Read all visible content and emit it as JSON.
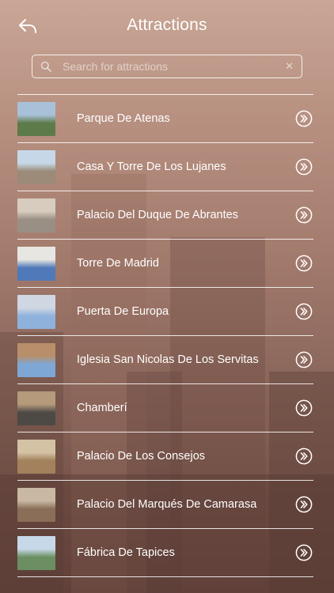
{
  "header": {
    "title": "Attractions",
    "back_icon": "back-arrow-icon"
  },
  "search": {
    "placeholder": "Search for attractions",
    "value": ""
  },
  "items": [
    {
      "label": "Parque De Atenas",
      "thumb_colors": [
        "#5d7a4a",
        "#a9c1d8"
      ]
    },
    {
      "label": "Casa Y Torre De Los Lujanes",
      "thumb_colors": [
        "#9b8b78",
        "#c6d8e8"
      ]
    },
    {
      "label": "Palacio Del Duque De Abrantes",
      "thumb_colors": [
        "#9a8f84",
        "#d7ccbd"
      ]
    },
    {
      "label": "Torre De Madrid",
      "thumb_colors": [
        "#4f79b8",
        "#e8e6e2"
      ]
    },
    {
      "label": "Puerta De Europa",
      "thumb_colors": [
        "#8fb2dc",
        "#cfd8e2"
      ]
    },
    {
      "label": "Iglesia San Nicolas De Los Servitas",
      "thumb_colors": [
        "#7fa7d6",
        "#b98e6a"
      ]
    },
    {
      "label": "Chamberí",
      "thumb_colors": [
        "#4d4a46",
        "#b59a7b"
      ]
    },
    {
      "label": "Palacio De Los Consejos",
      "thumb_colors": [
        "#a3815c",
        "#d4c2a5"
      ]
    },
    {
      "label": "Palacio Del Marqués De Camarasa",
      "thumb_colors": [
        "#8a6e58",
        "#c9b9a3"
      ]
    },
    {
      "label": "Fábrica De Tapices",
      "thumb_colors": [
        "#6b8f62",
        "#c7d9e8"
      ]
    }
  ]
}
